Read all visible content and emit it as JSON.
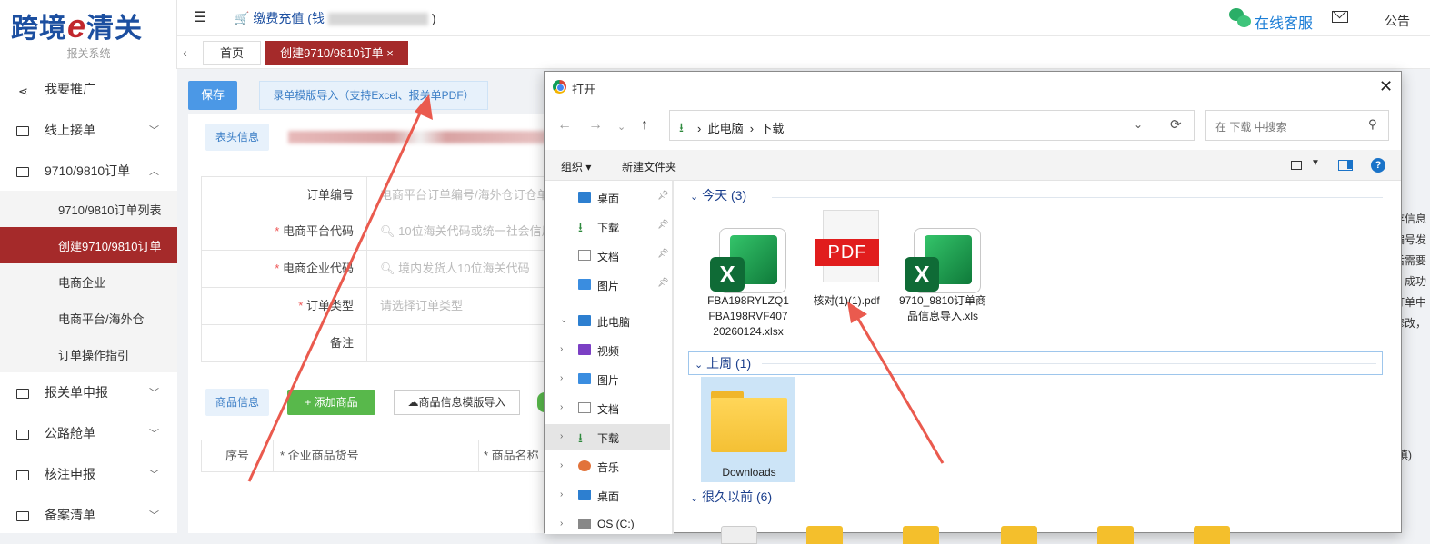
{
  "logo": {
    "name": "跨境",
    "e": "e",
    "name2": "清关",
    "sub": "报关系统"
  },
  "topbar": {
    "recharge_label": "缴费充值 (钱",
    "recharge_tail": ")",
    "customer_service": "在线客服",
    "notice": "公告"
  },
  "tabs": {
    "home": "首页",
    "active": "创建9710/9810订单",
    "close": "×"
  },
  "sidebar": {
    "items": [
      {
        "label": "我要推广"
      },
      {
        "label": "线上接单"
      },
      {
        "label": "9710/9810订单"
      },
      {
        "label": "报关单申报"
      },
      {
        "label": "公路舱单"
      },
      {
        "label": "核注申报"
      },
      {
        "label": "备案清单"
      }
    ],
    "subitems": [
      {
        "label": "9710/9810订单列表"
      },
      {
        "label": "创建9710/9810订单"
      },
      {
        "label": "电商企业"
      },
      {
        "label": "电商平台/海外仓"
      },
      {
        "label": "订单操作指引"
      }
    ]
  },
  "main": {
    "save": "保存",
    "import_template": "录单模版导入（支持Excel、报关单PDF）",
    "head_info": "表头信息",
    "fields": [
      {
        "label": "订单编号",
        "required": false,
        "placeholder": "电商平台订单编号/海外仓订仓单号"
      },
      {
        "label": "电商平台代码",
        "required": true,
        "placeholder": "10位海关代码或统一社会信用代码"
      },
      {
        "label": "电商企业代码",
        "required": true,
        "placeholder": "境内发货人10位海关代码"
      },
      {
        "label": "订单类型",
        "required": true,
        "placeholder": "请选择订单类型"
      },
      {
        "label": "备注",
        "required": false,
        "placeholder": ""
      }
    ],
    "required_mark": "*",
    "goods_info": "商品信息",
    "add_goods": "+ 添加商品",
    "goods_import": "商品信息模版导入",
    "goods_columns": [
      "序号",
      "* 企业商品货号",
      "* 商品名称"
    ],
    "right_text": [
      "存信息",
      "编号发",
      "后需要",
      "，成功",
      "订单中",
      "修改，"
    ],
    "right_tail": "填)"
  },
  "dialog": {
    "title": "打开",
    "close": "✕",
    "breadcrumb": [
      "此电脑",
      "下载"
    ],
    "search_placeholder": "在 下载 中搜索",
    "toolbar": {
      "organize": "组织 ▾",
      "new_folder": "新建文件夹",
      "help": "?"
    },
    "tree": [
      {
        "label": "桌面",
        "icon": "desktop-icon",
        "pinned": true,
        "expander": ""
      },
      {
        "label": "下载",
        "icon": "download-icon",
        "pinned": true,
        "expander": ""
      },
      {
        "label": "文档",
        "icon": "document-icon",
        "pinned": true,
        "expander": ""
      },
      {
        "label": "图片",
        "icon": "picture-icon",
        "pinned": true,
        "expander": ""
      },
      {
        "label": "此电脑",
        "icon": "computer-icon",
        "pinned": false,
        "expander": "⌄"
      },
      {
        "label": "视频",
        "icon": "video-icon",
        "pinned": false,
        "expander": "›"
      },
      {
        "label": "图片",
        "icon": "picture-icon",
        "pinned": false,
        "expander": "›"
      },
      {
        "label": "文档",
        "icon": "document-icon",
        "pinned": false,
        "expander": "›"
      },
      {
        "label": "下载",
        "icon": "download-icon",
        "pinned": false,
        "expander": "›"
      },
      {
        "label": "音乐",
        "icon": "music-icon",
        "pinned": false,
        "expander": "›"
      },
      {
        "label": "桌面",
        "icon": "desktop-icon",
        "pinned": false,
        "expander": "›"
      },
      {
        "label": "OS (C:)",
        "icon": "drive-icon",
        "pinned": false,
        "expander": "›"
      }
    ],
    "groups": {
      "today": "今天 (3)",
      "last_week": "上周 (1)",
      "long_ago": "很久以前 (6)"
    },
    "files_today": [
      {
        "name": "FBA198RYLZQ1 FBA198RVF407 20260124.xlsx",
        "type": "xlsx"
      },
      {
        "name": "核对(1)(1).pdf",
        "type": "pdf"
      },
      {
        "name": "9710_9810订单商品信息导入.xls",
        "type": "xls"
      }
    ],
    "files_last_week": [
      {
        "name": "Downloads",
        "type": "folder"
      }
    ],
    "icon_texts": {
      "excel": "X",
      "pdf": "PDF"
    }
  },
  "colors": {
    "brand_red": "#a52a2a",
    "brand_blue": "#1c4fa0",
    "arrow": "#ea5a4e"
  }
}
